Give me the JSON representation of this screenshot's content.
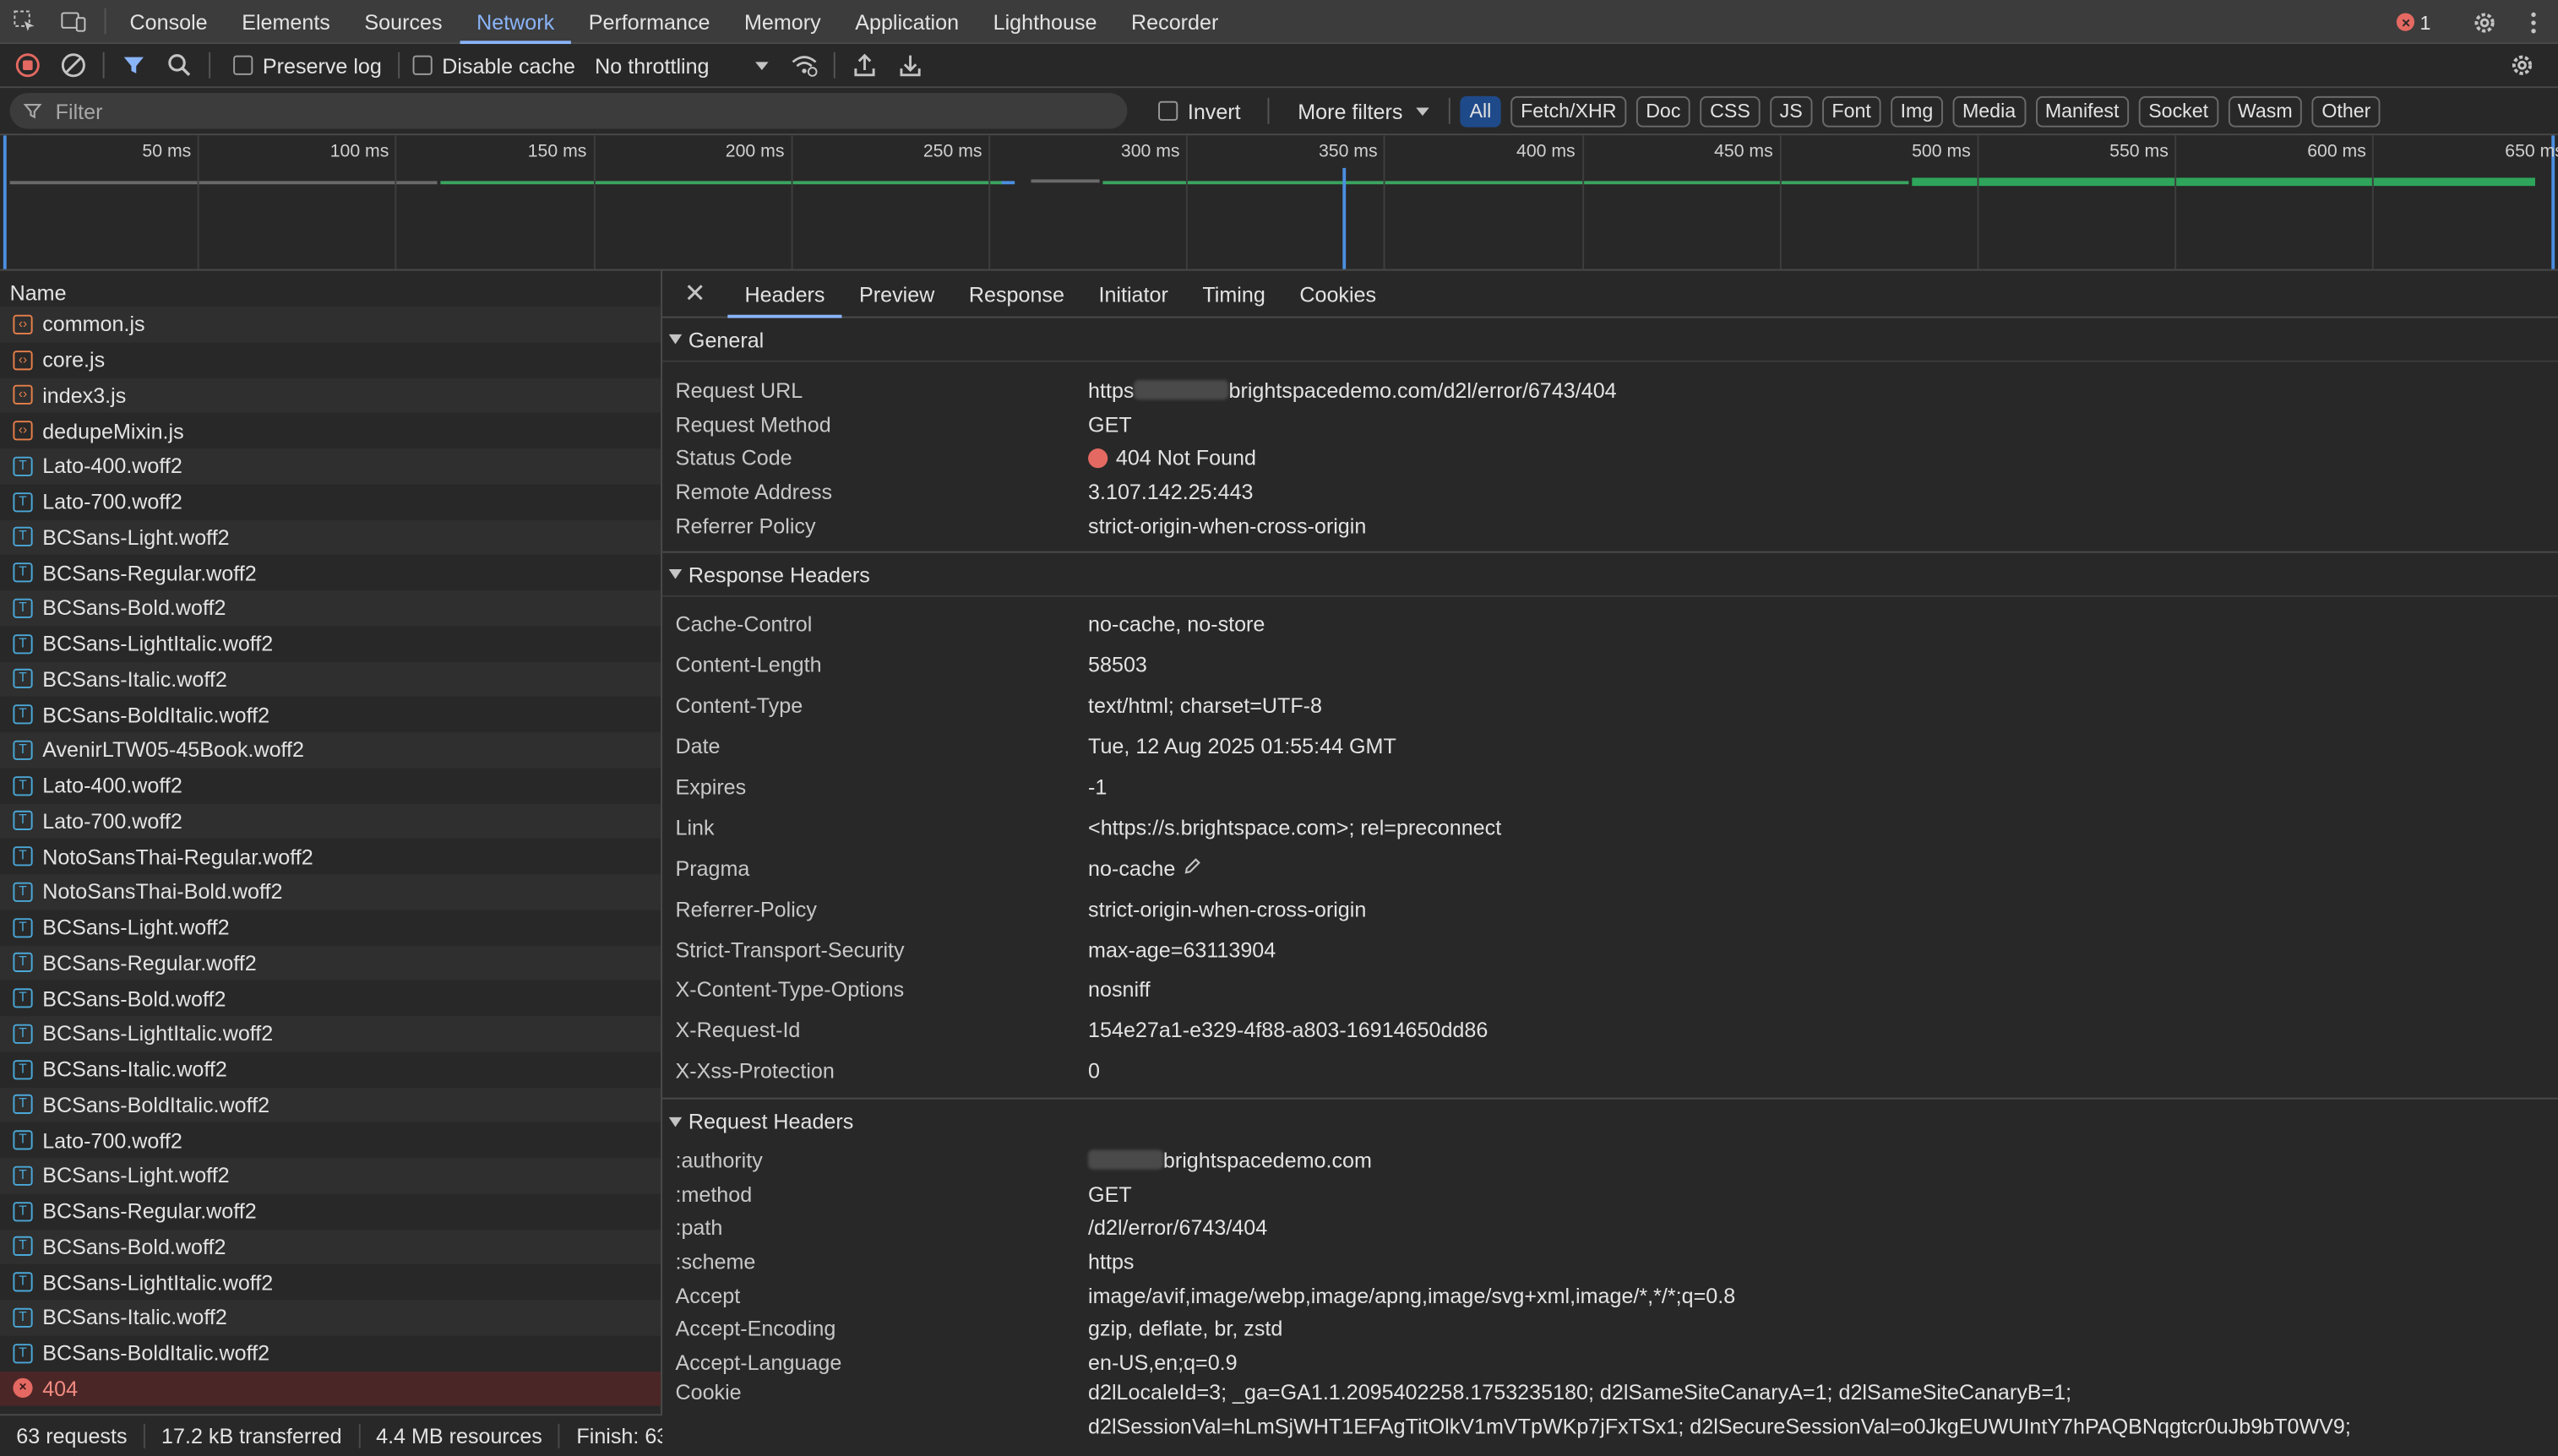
{
  "tabs": [
    "Console",
    "Elements",
    "Sources",
    "Network",
    "Performance",
    "Memory",
    "Application",
    "Lighthouse",
    "Recorder"
  ],
  "active_tab": "Network",
  "error_count": "1",
  "toolbar": {
    "preserve_log": "Preserve log",
    "disable_cache": "Disable cache",
    "throttling": "No throttling"
  },
  "filter": {
    "placeholder": "Filter",
    "invert": "Invert",
    "more_filters": "More filters",
    "types": [
      "All",
      "Fetch/XHR",
      "Doc",
      "CSS",
      "JS",
      "Font",
      "Img",
      "Media",
      "Manifest",
      "Socket",
      "Wasm",
      "Other"
    ]
  },
  "overview": {
    "ticks": [
      "50 ms",
      "100 ms",
      "150 ms",
      "200 ms",
      "250 ms",
      "300 ms",
      "350 ms",
      "400 ms",
      "450 ms",
      "500 ms",
      "550 ms",
      "600 ms",
      "650 ms"
    ]
  },
  "list": {
    "header": "Name",
    "rows": [
      {
        "name": "common.js",
        "type": "js"
      },
      {
        "name": "core.js",
        "type": "js"
      },
      {
        "name": "index3.js",
        "type": "js"
      },
      {
        "name": "dedupeMixin.js",
        "type": "js"
      },
      {
        "name": "Lato-400.woff2",
        "type": "font"
      },
      {
        "name": "Lato-700.woff2",
        "type": "font"
      },
      {
        "name": "BCSans-Light.woff2",
        "type": "font"
      },
      {
        "name": "BCSans-Regular.woff2",
        "type": "font"
      },
      {
        "name": "BCSans-Bold.woff2",
        "type": "font"
      },
      {
        "name": "BCSans-LightItalic.woff2",
        "type": "font"
      },
      {
        "name": "BCSans-Italic.woff2",
        "type": "font"
      },
      {
        "name": "BCSans-BoldItalic.woff2",
        "type": "font"
      },
      {
        "name": "AvenirLTW05-45Book.woff2",
        "type": "font"
      },
      {
        "name": "Lato-400.woff2",
        "type": "font"
      },
      {
        "name": "Lato-700.woff2",
        "type": "font"
      },
      {
        "name": "NotoSansThai-Regular.woff2",
        "type": "font"
      },
      {
        "name": "NotoSansThai-Bold.woff2",
        "type": "font"
      },
      {
        "name": "BCSans-Light.woff2",
        "type": "font"
      },
      {
        "name": "BCSans-Regular.woff2",
        "type": "font"
      },
      {
        "name": "BCSans-Bold.woff2",
        "type": "font"
      },
      {
        "name": "BCSans-LightItalic.woff2",
        "type": "font"
      },
      {
        "name": "BCSans-Italic.woff2",
        "type": "font"
      },
      {
        "name": "BCSans-BoldItalic.woff2",
        "type": "font"
      },
      {
        "name": "Lato-700.woff2",
        "type": "font"
      },
      {
        "name": "BCSans-Light.woff2",
        "type": "font"
      },
      {
        "name": "BCSans-Regular.woff2",
        "type": "font"
      },
      {
        "name": "BCSans-Bold.woff2",
        "type": "font"
      },
      {
        "name": "BCSans-LightItalic.woff2",
        "type": "font"
      },
      {
        "name": "BCSans-Italic.woff2",
        "type": "font"
      },
      {
        "name": "BCSans-BoldItalic.woff2",
        "type": "font"
      },
      {
        "name": "404",
        "type": "error"
      }
    ]
  },
  "status": {
    "requests": "63 requests",
    "transferred": "17.2 kB transferred",
    "resources": "4.4 MB resources",
    "finish": "Finish: 63"
  },
  "detail": {
    "tabs": [
      "Headers",
      "Preview",
      "Response",
      "Initiator",
      "Timing",
      "Cookies"
    ],
    "active": "Headers",
    "general": {
      "title": "General",
      "rows": [
        {
          "k": "Request URL",
          "pre": "https",
          "v": "brightspacedemo.com/d2l/error/6743/404"
        },
        {
          "k": "Request Method",
          "v": "GET"
        },
        {
          "k": "Status Code",
          "v": "404 Not Found"
        },
        {
          "k": "Remote Address",
          "v": "3.107.142.25:443"
        },
        {
          "k": "Referrer Policy",
          "v": "strict-origin-when-cross-origin"
        }
      ]
    },
    "response": {
      "title": "Response Headers",
      "rows": [
        {
          "k": "Cache-Control",
          "v": "no-cache, no-store"
        },
        {
          "k": "Content-Length",
          "v": "58503"
        },
        {
          "k": "Content-Type",
          "v": "text/html; charset=UTF-8"
        },
        {
          "k": "Date",
          "v": "Tue, 12 Aug 2025 01:55:44 GMT"
        },
        {
          "k": "Expires",
          "v": "-1"
        },
        {
          "k": "Link",
          "v": "<https://s.brightspace.com>; rel=preconnect"
        },
        {
          "k": "Pragma",
          "v": "no-cache"
        },
        {
          "k": "Referrer-Policy",
          "v": "strict-origin-when-cross-origin"
        },
        {
          "k": "Strict-Transport-Security",
          "v": "max-age=63113904"
        },
        {
          "k": "X-Content-Type-Options",
          "v": "nosniff"
        },
        {
          "k": "X-Request-Id",
          "v": "154e27a1-e329-4f88-a803-16914650dd86"
        },
        {
          "k": "X-Xss-Protection",
          "v": "0"
        }
      ]
    },
    "request": {
      "title": "Request Headers",
      "rows": [
        {
          "k": ":authority",
          "v": "brightspacedemo.com"
        },
        {
          "k": ":method",
          "v": "GET"
        },
        {
          "k": ":path",
          "v": "/d2l/error/6743/404"
        },
        {
          "k": ":scheme",
          "v": "https"
        },
        {
          "k": "Accept",
          "v": "image/avif,image/webp,image/apng,image/svg+xml,image/*,*/*;q=0.8"
        },
        {
          "k": "Accept-Encoding",
          "v": "gzip, deflate, br, zstd"
        },
        {
          "k": "Accept-Language",
          "v": "en-US,en;q=0.9"
        },
        {
          "k": "Cookie",
          "v": "d2lLocaleId=3; _ga=GA1.1.2095402258.1753235180; d2lSameSiteCanaryA=1; d2lSameSiteCanaryB=1;",
          "v2": "d2lSessionVal=hLmSjWHT1EFAgTitOlkV1mVTpWKp7jFxTSx1; d2lSecureSessionVal=o0JkgEUWUIntY7hPAQBNqgtcr0uJb9bT0WV9;"
        }
      ]
    }
  }
}
